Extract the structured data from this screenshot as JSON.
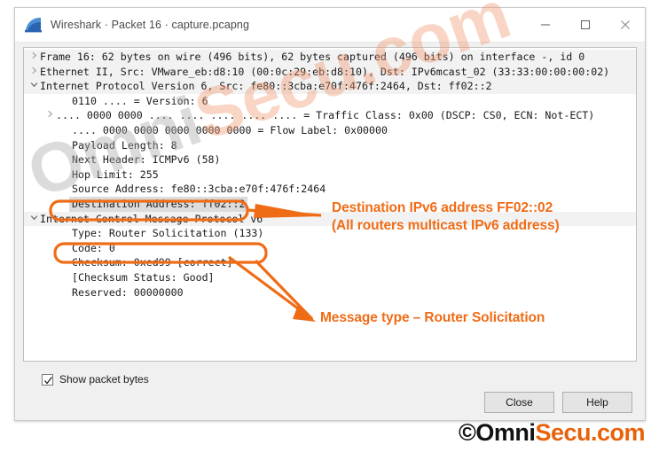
{
  "window": {
    "title": "Wireshark · Packet 16 · capture.pcapng",
    "logo_icon": "wireshark-fin-icon",
    "controls": {
      "minimize_icon": "minimize-icon",
      "maximize_icon": "maximize-icon",
      "close_icon": "close-icon"
    }
  },
  "tree": {
    "rows": [
      {
        "expander": "chevron-right-icon",
        "indent": 0,
        "text": "Frame 16: 62 bytes on wire (496 bits), 62 bytes captured (496 bits) on interface -, id 0",
        "band": true,
        "selected": false
      },
      {
        "expander": "chevron-right-icon",
        "indent": 0,
        "text": "Ethernet II, Src: VMware_eb:d8:10 (00:0c:29:eb:d8:10), Dst: IPv6mcast_02 (33:33:00:00:00:02)",
        "band": true,
        "selected": false
      },
      {
        "expander": "chevron-down-icon",
        "indent": 0,
        "text": "Internet Protocol Version 6, Src: fe80::3cba:e70f:476f:2464, Dst: ff02::2",
        "band": true,
        "selected": false
      },
      {
        "expander": "",
        "indent": 2,
        "text": "0110 .... = Version: 6",
        "band": false,
        "selected": false
      },
      {
        "expander": "chevron-right-icon",
        "indent": 1,
        "text": ".... 0000 0000 .... .... .... .... .... = Traffic Class: 0x00 (DSCP: CS0, ECN: Not-ECT)",
        "band": false,
        "selected": false
      },
      {
        "expander": "",
        "indent": 2,
        "text": ".... 0000 0000 0000 0000 0000 = Flow Label: 0x00000",
        "band": false,
        "selected": false
      },
      {
        "expander": "",
        "indent": 2,
        "text": "Payload Length: 8",
        "band": false,
        "selected": false
      },
      {
        "expander": "",
        "indent": 2,
        "text": "Next Header: ICMPv6 (58)",
        "band": false,
        "selected": false
      },
      {
        "expander": "",
        "indent": 2,
        "text": "Hop Limit: 255",
        "band": false,
        "selected": false
      },
      {
        "expander": "",
        "indent": 2,
        "text": "Source Address: fe80::3cba:e70f:476f:2464",
        "band": false,
        "selected": false
      },
      {
        "expander": "",
        "indent": 2,
        "text": "Destination Address: ff02::2",
        "band": false,
        "selected": true
      },
      {
        "expander": "chevron-down-icon",
        "indent": 0,
        "text": "Internet Control Message Protocol v6",
        "band": true,
        "selected": false
      },
      {
        "expander": "",
        "indent": 2,
        "text": "Type: Router Solicitation (133)",
        "band": false,
        "selected": false
      },
      {
        "expander": "",
        "indent": 2,
        "text": "Code: 0",
        "band": false,
        "selected": false
      },
      {
        "expander": "",
        "indent": 2,
        "text": "Checksum: 0xed99 [correct]",
        "band": false,
        "selected": false
      },
      {
        "expander": "",
        "indent": 2,
        "text": "[Checksum Status: Good]",
        "band": false,
        "selected": false
      },
      {
        "expander": "",
        "indent": 2,
        "text": "Reserved: 00000000",
        "band": false,
        "selected": false
      }
    ]
  },
  "footer": {
    "show_packet_bytes_label": "Show packet bytes",
    "show_packet_bytes_checked": true,
    "check_icon": "check-icon",
    "close_button": "Close",
    "help_button": "Help"
  },
  "annotations": {
    "accent_color": "#ef6c17",
    "destination_line1": "Destination IPv6 address FF02::02",
    "destination_line2": "(All routers multicast IPv6 address)",
    "message_type": "Message type – Router Solicitation"
  },
  "watermark": {
    "text_part1": "Omni",
    "text_part2": "Secu.com"
  },
  "brand": {
    "copyright": "©Omni",
    "name": "Secu.com",
    "black": "#111111",
    "orange": "#e8620c"
  }
}
